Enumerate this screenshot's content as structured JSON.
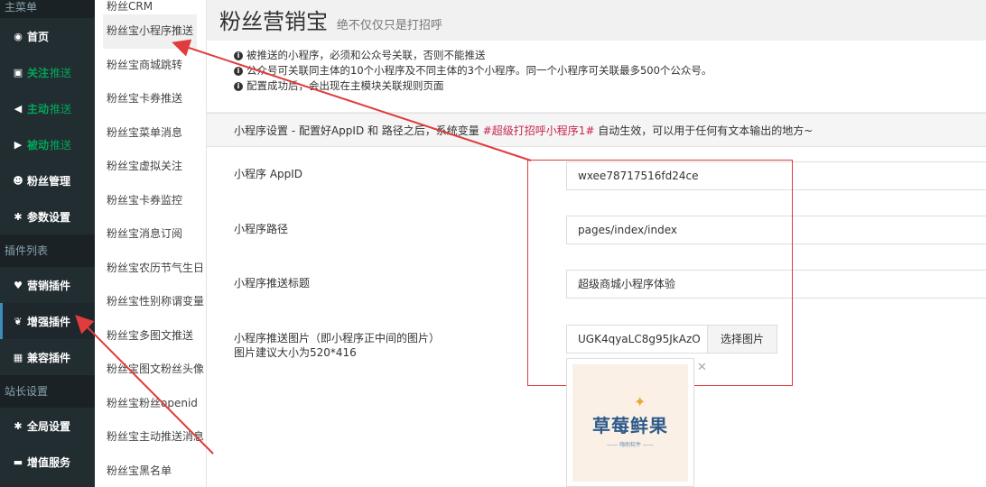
{
  "sidebar": {
    "section_main": "主菜单",
    "items": [
      {
        "label": "首页",
        "icon": "dashboard-icon"
      },
      {
        "label": "关注",
        "suffix": "推送",
        "icon": "rss-icon"
      },
      {
        "label": "主动",
        "suffix": "推送",
        "icon": "arrow-circle-left-icon"
      },
      {
        "label": "被动",
        "suffix": "推送",
        "icon": "arrow-circle-right-icon"
      },
      {
        "label": "粉丝管理",
        "icon": "users-icon"
      },
      {
        "label": "参数设置",
        "icon": "gear-icon"
      }
    ],
    "section_plugins": "插件列表",
    "plugin_items": [
      {
        "label": "营销插件",
        "icon": "heart-icon"
      },
      {
        "label": "增强插件",
        "icon": "paw-icon"
      },
      {
        "label": "兼容插件",
        "icon": "grid-icon"
      }
    ],
    "section_admin": "站长设置",
    "admin_items": [
      {
        "label": "全局设置",
        "icon": "gear-icon"
      },
      {
        "label": "增值服务",
        "icon": "credit-card-icon"
      }
    ]
  },
  "submenu": {
    "items": [
      "粉丝CRM",
      "粉丝宝小程序推送",
      "粉丝宝商城跳转",
      "粉丝宝卡券推送",
      "粉丝宝菜单消息",
      "粉丝宝虚拟关注",
      "粉丝宝卡券监控",
      "粉丝宝消息订阅",
      "粉丝宝农历节气生日",
      "粉丝宝性别称谓变量",
      "粉丝宝多图文推送",
      "粉丝宝图文粉丝头像",
      "粉丝宝粉丝openid",
      "粉丝宝主动推送消息",
      "粉丝宝黑名单"
    ]
  },
  "header": {
    "title": "粉丝营销宝",
    "subtitle": "绝不仅仅只是打招呼"
  },
  "notes": [
    "被推送的小程序，必须和公众号关联，否则不能推送",
    "公众号可关联同主体的10个小程序及不同主体的3个小程序。同一个小程序可关联最多500个公众号。",
    "配置成功后，会出现在主模块关联规则页面"
  ],
  "panel": {
    "heading_prefix": "小程序设置 - 配置好AppID 和 路径之后，系统变量 ",
    "heading_var": "#超级打招呼小程序1#",
    "heading_suffix": " 自动生效，可以用于任何有文本输出的地方~"
  },
  "form": {
    "appid_label": "小程序 AppID",
    "appid_value": "wxee78717516fd24ce",
    "path_label": "小程序路径",
    "path_value": "pages/index/index",
    "title_label": "小程序推送标题",
    "title_value": "超级商城小程序体验",
    "image_label": "小程序推送图片（即小程序正中间的图片）",
    "image_hint": "图片建议大小为520*416",
    "image_value": "UGK4qyaLC8g95JkAzO",
    "choose_button": "选择图片",
    "preview_brand": "草莓鲜果",
    "preview_brand_sub": "—— 嗨助软件 ——"
  },
  "colors": {
    "sidebar_bg": "#222d32",
    "accent_green": "#00a65a",
    "annotation_red": "#e03c3c",
    "variable_red": "#c7254e"
  }
}
